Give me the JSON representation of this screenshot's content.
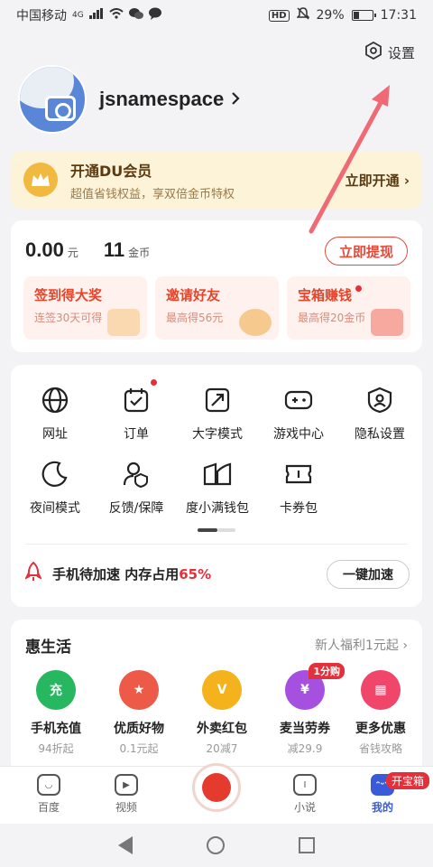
{
  "status_bar": {
    "carrier": "中国移动",
    "network": "4G",
    "battery": "29%",
    "battery_level": 0.29,
    "time": "17:31"
  },
  "header": {
    "settings_label": "设置"
  },
  "profile": {
    "username": "jsnamespace"
  },
  "vip": {
    "title": "开通DU会员",
    "subtitle": "超值省钱权益，享双倍金币特权",
    "action": "立即开通"
  },
  "wallet": {
    "cash": "0.00",
    "cash_unit": "元",
    "coins": "11",
    "coins_unit": "金币",
    "withdraw_label": "立即提现",
    "tasks": [
      {
        "title": "签到得大奖",
        "subtitle": "连签30天可得"
      },
      {
        "title": "邀请好友",
        "subtitle": "最高得56元"
      },
      {
        "title": "宝箱赚钱",
        "subtitle": "最高得20金币"
      }
    ]
  },
  "tools": {
    "items": [
      {
        "label": "网址",
        "icon": "globe-icon"
      },
      {
        "label": "订单",
        "icon": "order-icon"
      },
      {
        "label": "大字模式",
        "icon": "large-font-icon"
      },
      {
        "label": "游戏中心",
        "icon": "gamepad-icon"
      },
      {
        "label": "隐私设置",
        "icon": "privacy-icon"
      },
      {
        "label": "夜间模式",
        "icon": "moon-icon"
      },
      {
        "label": "反馈/保障",
        "icon": "feedback-icon"
      },
      {
        "label": "度小满钱包",
        "icon": "wallet-icon"
      },
      {
        "label": "卡券包",
        "icon": "coupon-icon"
      }
    ],
    "speed_text": "手机待加速 内存占用",
    "speed_pct": "65%",
    "speed_button": "一键加速"
  },
  "life": {
    "title": "惠生活",
    "more": "新人福利1元起",
    "items": [
      {
        "name": "手机充值",
        "sub": "94折起",
        "badge_text": "充",
        "color": "#27b760"
      },
      {
        "name": "优质好物",
        "sub": "0.1元起",
        "badge_text": "★",
        "color": "#ee5a48"
      },
      {
        "name": "外卖红包",
        "sub": "20减7",
        "badge_text": "V",
        "color": "#f4b31c"
      },
      {
        "name": "麦当劳券",
        "sub": "减29.9",
        "badge_text": "¥",
        "color": "#a650e0",
        "tag": "1分购"
      },
      {
        "name": "更多优惠",
        "sub": "省钱攻略",
        "badge_text": "▦",
        "color": "#f0466a"
      }
    ]
  },
  "tabbar": {
    "tabs": [
      {
        "label": "百度"
      },
      {
        "label": "视频"
      },
      {
        "label": "小说"
      },
      {
        "label": "我的"
      }
    ],
    "open_tag": "开宝箱"
  },
  "colors": {
    "accent": "#e3303a",
    "blue": "#3a5bd9",
    "vip_bg": "#fdf3d9"
  }
}
